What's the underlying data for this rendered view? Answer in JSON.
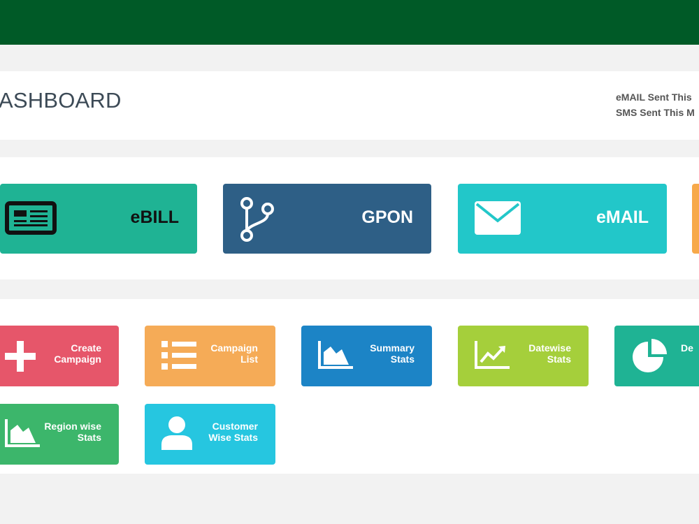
{
  "header": {
    "page_title": "ASHBOARD",
    "stats": [
      {
        "label": "eMAIL Sent This"
      },
      {
        "label": "SMS Sent This M"
      }
    ]
  },
  "services": [
    {
      "label": "eBILL",
      "icon": "newspaper-icon",
      "color": "#1fb394",
      "text_color": "#111111"
    },
    {
      "label": "GPON",
      "icon": "branch-icon",
      "color": "#2e5f86"
    },
    {
      "label": "eMAIL",
      "icon": "envelope-icon",
      "color": "#22c7c9"
    },
    {
      "label": "",
      "icon": "",
      "color": "#f7a94a"
    }
  ],
  "actions": [
    {
      "label": "Create\nCampaign",
      "icon": "plus-icon",
      "color": "#e6566a"
    },
    {
      "label": "Campaign\nList",
      "icon": "list-icon",
      "color": "#f5ab57"
    },
    {
      "label": "Summary\nStats",
      "icon": "area-chart-icon",
      "color": "#1c84c6"
    },
    {
      "label": "Datewise\nStats",
      "icon": "trend-chart-icon",
      "color": "#a5cf3b"
    },
    {
      "label": "De",
      "icon": "pie-chart-icon",
      "color": "#1fb394"
    },
    {
      "label": "Region wise\nStats",
      "icon": "area-chart-icon",
      "color": "#3cb66b"
    },
    {
      "label": "Customer\nWise Stats",
      "icon": "user-icon",
      "color": "#26c6e0"
    }
  ]
}
